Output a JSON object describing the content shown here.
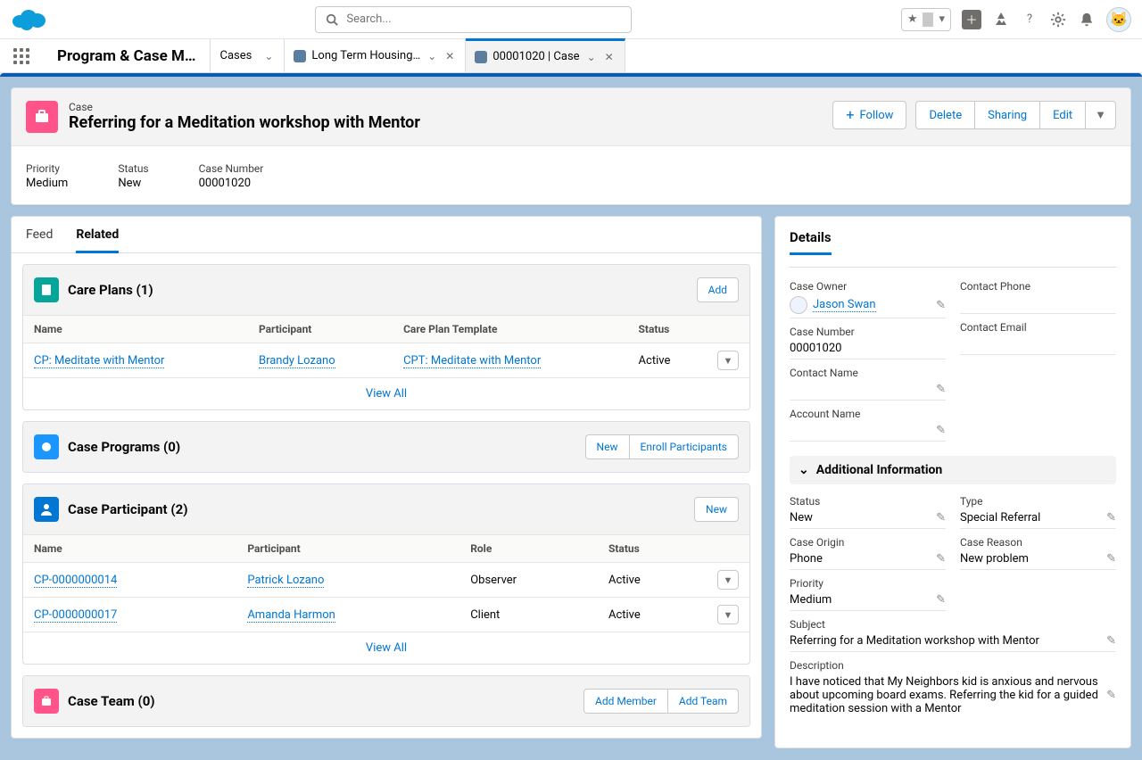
{
  "search": {
    "placeholder": "Search..."
  },
  "nav": {
    "app_name": "Program & Case M…",
    "tabs": [
      {
        "label": "Cases",
        "has_icon": false,
        "closable": false,
        "active": false
      },
      {
        "label": "Long Term Housing…",
        "has_icon": true,
        "closable": true,
        "active": false
      },
      {
        "label": "00001020 | Case",
        "has_icon": true,
        "closable": true,
        "active": true
      }
    ]
  },
  "record": {
    "object": "Case",
    "title": "Referring for a Meditation workshop with Mentor",
    "actions": {
      "follow": "Follow",
      "delete": "Delete",
      "sharing": "Sharing",
      "edit": "Edit"
    },
    "highlights": {
      "priority_label": "Priority",
      "priority_value": "Medium",
      "status_label": "Status",
      "status_value": "New",
      "casenum_label": "Case Number",
      "casenum_value": "00001020"
    }
  },
  "tabs": {
    "feed": "Feed",
    "related": "Related"
  },
  "care_plans": {
    "title": "Care Plans (1)",
    "add": "Add",
    "cols": {
      "name": "Name",
      "participant": "Participant",
      "template": "Care Plan Template",
      "status": "Status"
    },
    "rows": [
      {
        "name": "CP: Meditate with Mentor",
        "participant": "Brandy Lozano",
        "template": "CPT: Meditate with Mentor",
        "status": "Active"
      }
    ],
    "view_all": "View All"
  },
  "case_programs": {
    "title": "Case Programs (0)",
    "new": "New",
    "enroll": "Enroll Participants"
  },
  "case_participant": {
    "title": "Case Participant (2)",
    "new": "New",
    "cols": {
      "name": "Name",
      "participant": "Participant",
      "role": "Role",
      "status": "Status"
    },
    "rows": [
      {
        "name": "CP-0000000014",
        "participant": "Patrick Lozano",
        "role": "Observer",
        "status": "Active"
      },
      {
        "name": "CP-0000000017",
        "participant": "Amanda Harmon",
        "role": "Client",
        "status": "Active"
      }
    ],
    "view_all": "View All"
  },
  "case_team": {
    "title": "Case Team (0)",
    "add_member": "Add Member",
    "add_team": "Add Team"
  },
  "details": {
    "title": "Details",
    "labels": {
      "case_owner": "Case Owner",
      "contact_phone": "Contact Phone",
      "case_number": "Case Number",
      "contact_email": "Contact Email",
      "contact_name": "Contact Name",
      "account_name": "Account Name",
      "section": "Additional Information",
      "status": "Status",
      "type": "Type",
      "case_origin": "Case Origin",
      "case_reason": "Case Reason",
      "priority": "Priority",
      "subject": "Subject",
      "description": "Description"
    },
    "values": {
      "case_owner": "Jason Swan",
      "case_number": "00001020",
      "status": "New",
      "type": "Special Referral",
      "case_origin": "Phone",
      "case_reason": "New problem",
      "priority": "Medium",
      "subject": "Referring for a Meditation workshop with Mentor",
      "description": "I have noticed that My Neighbors kid is anxious and nervous about upcoming board exams. Referring the kid for a guided meditation session with a Mentor"
    }
  }
}
